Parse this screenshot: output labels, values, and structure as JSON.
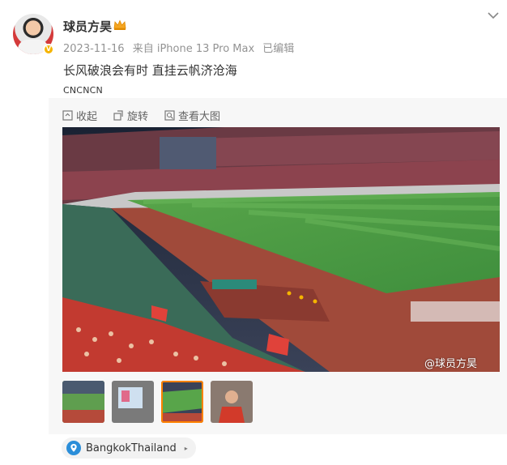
{
  "post": {
    "username": "球员方昊",
    "date": "2023-11-16",
    "source": "来自 iPhone 13 Pro Max",
    "edited": "已编辑",
    "content": "长风破浪会有时 直挂云帆济沧海",
    "tag": "CNCNCN",
    "watermark": "@球员方昊"
  },
  "actions": {
    "collapse": "收起",
    "rotate": "旋转",
    "view_large": "查看大图"
  },
  "thumbnails": [
    {
      "name": "thumb-1",
      "active": false
    },
    {
      "name": "thumb-2",
      "active": false
    },
    {
      "name": "thumb-3",
      "active": true
    },
    {
      "name": "thumb-4",
      "active": false
    }
  ],
  "location": {
    "label": "BangkokThailand",
    "icon": "map-pin-icon",
    "color": "#2b8ed9"
  },
  "colors": {
    "accent": "#ff8200",
    "meta_text": "#939393"
  }
}
